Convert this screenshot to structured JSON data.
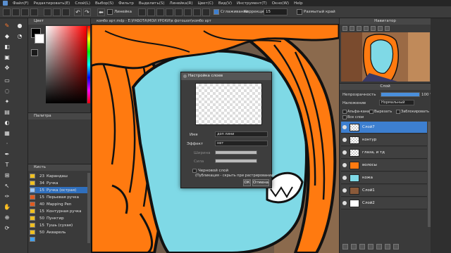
{
  "menu": {
    "items": [
      "Файл(F)",
      "Редактировать(E)",
      "Слой(L)",
      "Выбор(S)",
      "Фильтр",
      "Выделить(S)",
      "Линейка(R)",
      "Цвет(C)",
      "Вид(V)",
      "Инструмент(T)",
      "Окно(W)",
      "Help"
    ]
  },
  "toolbar": {
    "ruler_label": "Линейка",
    "snap_label": "Сглаживание",
    "correction_label": "Коррекция",
    "correction_value": "15",
    "blur_label": "Размытый край"
  },
  "panels": {
    "color_title": "Цвет",
    "palette_title": "Палитра",
    "brush_title": "Кисть",
    "navigator_title": "Навигатор",
    "layer_title": "Слой"
  },
  "canvas": {
    "tab_title": "комбо арт.mdp - E:\\РАБОТА\\МОИ УРОКИ\\в фотошоп\\комбо арт"
  },
  "brushes": [
    {
      "size": "23",
      "name": "Карандаш",
      "color": "#f0c020"
    },
    {
      "size": "34",
      "name": "Ручка",
      "color": "#f0c020"
    },
    {
      "size": "15",
      "name": "Ручка (острая)",
      "color": "#2f6fbd"
    },
    {
      "size": "15",
      "name": "Перьевая ручка",
      "color": "#e05a20"
    },
    {
      "size": "40",
      "name": "Mapping Pen",
      "color": "#e05a20"
    },
    {
      "size": "15",
      "name": "Контурная ручка",
      "color": "#f0c020"
    },
    {
      "size": "50",
      "name": "Пунктир",
      "color": "#f0c020"
    },
    {
      "size": "15",
      "name": "Тушь (сухая)",
      "color": "#f0c020"
    },
    {
      "size": "50",
      "name": "Акварель",
      "color": "#f0c020"
    },
    {
      "size": "",
      "name": "",
      "color": "#40a0f0"
    }
  ],
  "dialog": {
    "title": "Настройка слоев",
    "name_label": "Имя",
    "name_value": "доп лини",
    "effect_label": "Эффект",
    "effect_value": "нет",
    "width_label": "Ширина",
    "power_label": "Сила",
    "draft_label": "Черновой слой",
    "draft_note": "(Публикация - скрыть при растрировании)",
    "ok": "ОК",
    "cancel": "Отмена"
  },
  "layers": {
    "opacity_label": "Непрозрачность",
    "opacity_value": "100 %",
    "blend_label": "Наложение",
    "blend_value": "Нормальный",
    "alpha_label": "Альфа-канал",
    "clip_label": "Вырезать",
    "all_label": "Все слои",
    "lock_label": "Заблокировать",
    "items": [
      {
        "name": "Слой7",
        "selected": true
      },
      {
        "name": "контур",
        "selected": false
      },
      {
        "name": "глаза, и тд",
        "selected": false
      },
      {
        "name": "волосы",
        "selected": false
      },
      {
        "name": "кожа",
        "selected": false
      },
      {
        "name": "Слой1",
        "selected": false
      },
      {
        "name": "Слой2",
        "selected": false
      }
    ]
  },
  "colors": {
    "hair": "#ff7a10",
    "skin": "#7fd9e6",
    "accent": "#3d7fd0"
  }
}
